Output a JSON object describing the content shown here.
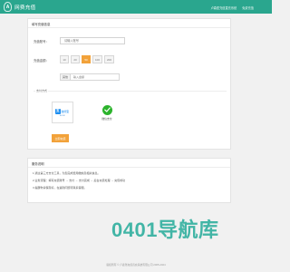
{
  "header": {
    "logo_glyph": "A",
    "logo_text": "网费充值",
    "nav": [
      "卢森堡充值直充系统",
      "免费充值"
    ]
  },
  "form": {
    "title": "填写充值信息",
    "account_label": "充值账号：",
    "account_placeholder": "请输入账号",
    "amount_label": "充值金额：",
    "amounts": [
      "10",
      "20",
      "50",
      "100",
      "200"
    ],
    "selected_amount": "50",
    "custom_prefix": "其他",
    "custom_placeholder": "输入金额",
    "pay_method_label": "支付方式",
    "alipay": {
      "icon": "alipay-icon",
      "mark": "支",
      "name": "支付宝",
      "sub": "ALIPAY",
      "color": "#1d8ef0"
    },
    "wechat": {
      "icon": "wechat-pay-icon",
      "name": "微信支付",
      "color": "#2cb32c"
    },
    "submit_label": "立即充值"
  },
  "notice": {
    "title": "服务说明",
    "lines": [
      "1.通过第三方支付工具，为您完成费用缴纳及相关信息。",
      "2.业务流程：填写充值账号 → 支付 → 支付完成 → 后台充值处理 → 充值成功",
      "3.提醒你请保存好，在遇到问题可联系客服。"
    ]
  },
  "watermark": "0401导航库",
  "footer": "版权所有 © 卢森堡充值直充系统有限公司 2005-2024",
  "colors": {
    "header": "#2aa68e",
    "accent": "#f2a23a",
    "background": "#f1f1f1"
  }
}
